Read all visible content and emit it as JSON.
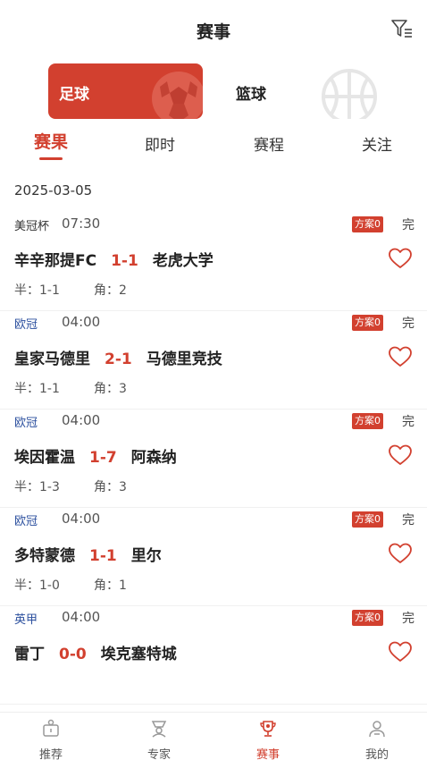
{
  "header": {
    "title": "赛事",
    "filter_icon": "filter-icon"
  },
  "sport_tabs": [
    {
      "label": "足球",
      "active": true,
      "icon": "soccer-ball-icon"
    },
    {
      "label": "篮球",
      "active": false,
      "icon": "basketball-icon"
    }
  ],
  "sub_tabs": [
    {
      "label": "赛果",
      "active": true
    },
    {
      "label": "即时",
      "active": false
    },
    {
      "label": "赛程",
      "active": false
    },
    {
      "label": "关注",
      "active": false
    }
  ],
  "date": "2025-03-05",
  "matches": [
    {
      "league": "美冠杯",
      "league_color": "#333333",
      "time": "07:30",
      "badge": "方案0",
      "status": "完",
      "home": "辛辛那提FC",
      "score": "1-1",
      "away": "老虎大学",
      "half": "半：1-1",
      "corner": "角：2"
    },
    {
      "league": "欧冠",
      "league_color": "#2b4f9e",
      "time": "04:00",
      "badge": "方案0",
      "status": "完",
      "home": "皇家马德里",
      "score": "2-1",
      "away": "马德里竞技",
      "half": "半：1-1",
      "corner": "角：3"
    },
    {
      "league": "欧冠",
      "league_color": "#2b4f9e",
      "time": "04:00",
      "badge": "方案0",
      "status": "完",
      "home": "埃因霍温",
      "score": "1-7",
      "away": "阿森纳",
      "half": "半：1-3",
      "corner": "角：3"
    },
    {
      "league": "欧冠",
      "league_color": "#2b4f9e",
      "time": "04:00",
      "badge": "方案0",
      "status": "完",
      "home": "多特蒙德",
      "score": "1-1",
      "away": "里尔",
      "half": "半：1-0",
      "corner": "角：1"
    },
    {
      "league": "英甲",
      "league_color": "#2b4f9e",
      "time": "04:00",
      "badge": "方案0",
      "status": "完",
      "home": "雷丁",
      "score": "0-0",
      "away": "埃克塞特城",
      "half": "",
      "corner": ""
    }
  ],
  "bottom_nav": [
    {
      "label": "推荐",
      "icon": "recommend-icon",
      "active": false
    },
    {
      "label": "专家",
      "icon": "expert-icon",
      "active": false
    },
    {
      "label": "赛事",
      "icon": "trophy-icon",
      "active": true
    },
    {
      "label": "我的",
      "icon": "user-icon",
      "active": false
    }
  ],
  "colors": {
    "accent": "#d2402f",
    "league_blue": "#2b4f9e"
  }
}
